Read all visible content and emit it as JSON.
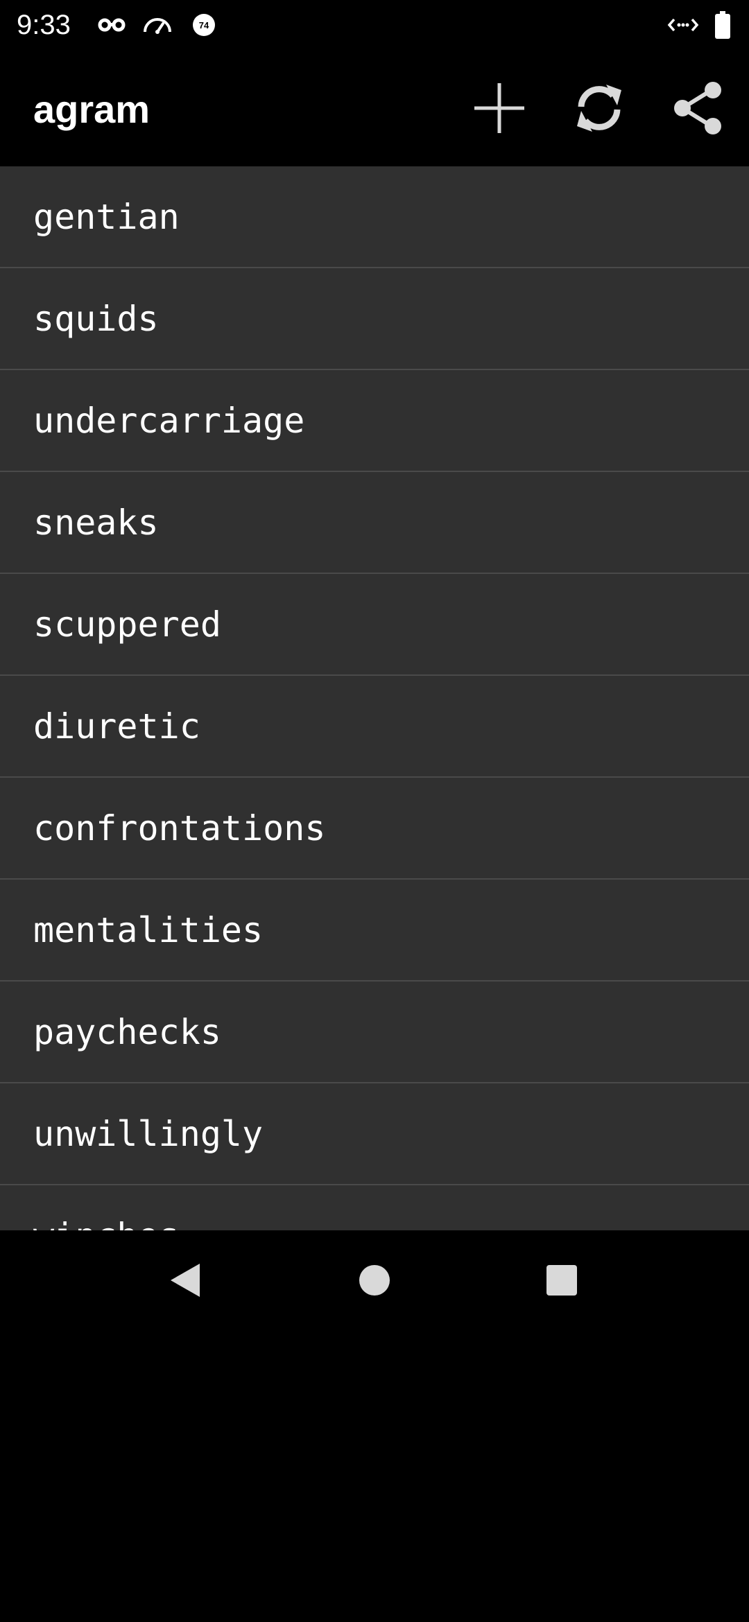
{
  "status_bar": {
    "time": "9:33",
    "icons": [
      "incognito-icon",
      "speedometer-icon",
      "speed-badge-icon",
      "code-arrows-icon",
      "battery-icon"
    ],
    "speed_badge": "74"
  },
  "app_bar": {
    "title": "agram",
    "actions": [
      "add-icon",
      "refresh-icon",
      "share-icon"
    ]
  },
  "words": [
    "gentian",
    "squids",
    "undercarriage",
    "sneaks",
    "scuppered",
    "diuretic",
    "confrontations",
    "mentalities",
    "paychecks",
    "unwillingly",
    "winches"
  ],
  "nav_bar": {
    "buttons": [
      "back-icon",
      "home-icon",
      "recents-icon"
    ]
  },
  "colors": {
    "background": "#000000",
    "list_background": "#303030",
    "divider": "#4a4a4a",
    "text": "#ffffff",
    "icon": "#d9d9d9"
  }
}
